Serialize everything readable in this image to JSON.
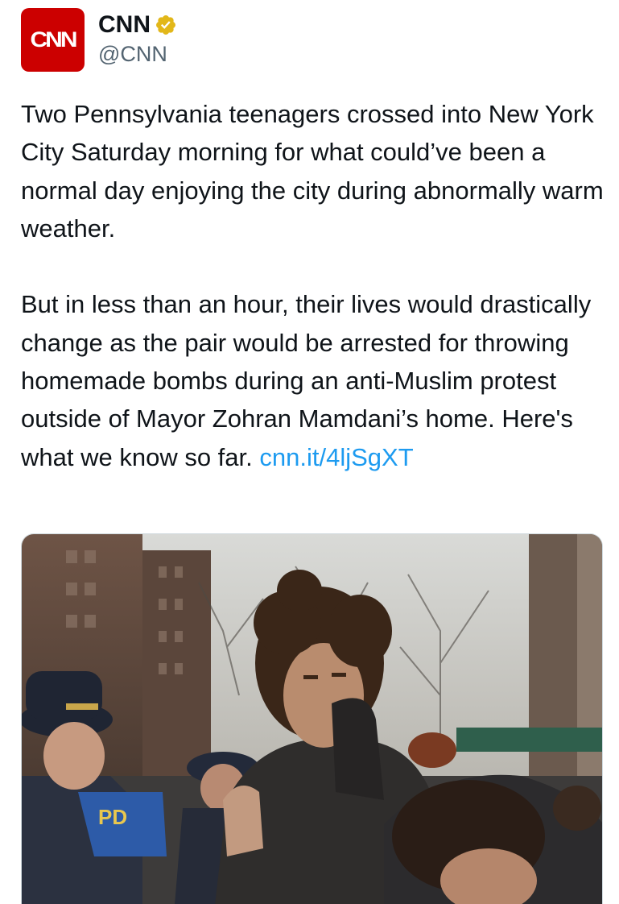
{
  "author": {
    "display_name": "CNN",
    "handle": "@CNN",
    "avatar_text": "CNN",
    "verified": true,
    "badge_color": "#e2b719",
    "brand_color": "#cc0000"
  },
  "tweet": {
    "paragraph_1": "Two Pennsylvania teenagers crossed into New York City Saturday morning for what could’ve been a normal day enjoying the city during abnormally warm weather.",
    "paragraph_2": "But in less than an hour, their lives would drastically change as the pair would be arrested for throwing homemade bombs during an anti-Muslim protest outside of Mayor Zohran Mamdani’s home. Here's what we know so far. ",
    "link": "cnn.it/4ljSgXT",
    "link_color": "#1d9bf0"
  },
  "media": {
    "type": "photo",
    "visible_text": "PD"
  }
}
